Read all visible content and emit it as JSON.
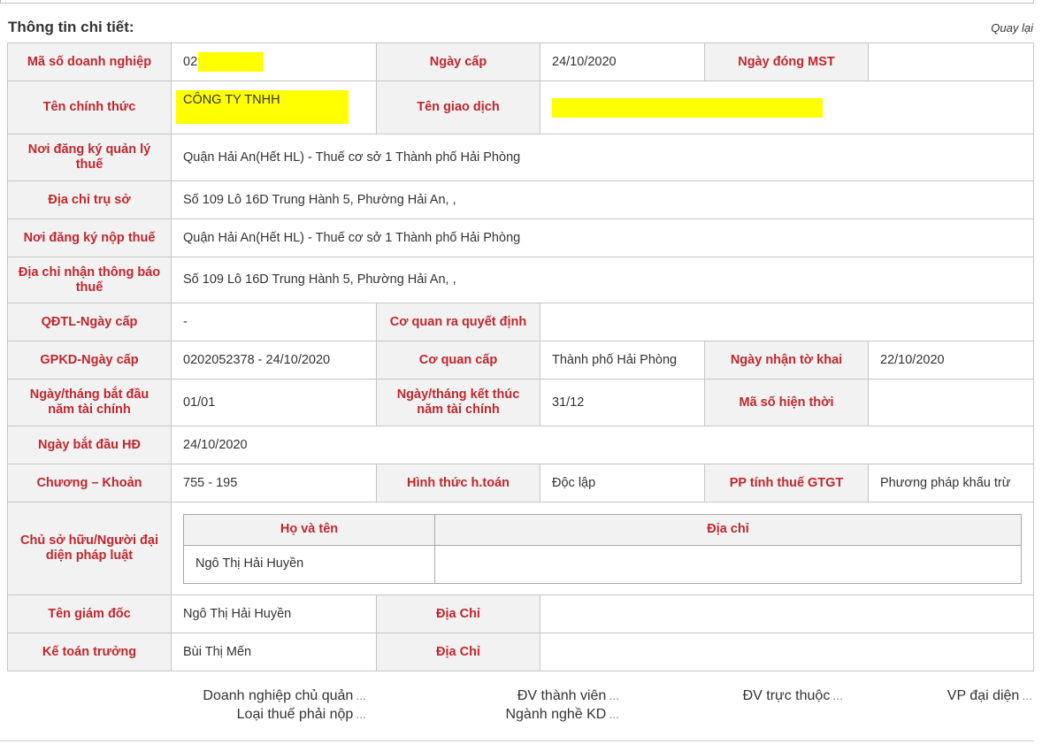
{
  "page": {
    "title": "Thông tin chi tiết:",
    "back_label": "Quay lại"
  },
  "colors": {
    "label": "#c0272d",
    "label_bg": "#f2f2f2",
    "border": "#c6c6c6",
    "redaction": "#ffff00"
  },
  "detail": {
    "ma_so_label": "Mã số doanh nghiệp",
    "ma_so_value": "02",
    "ngay_cap_label": "Ngày cấp",
    "ngay_cap_value": "24/10/2020",
    "ngay_dong_label": "Ngày đóng MST",
    "ngay_dong_value": "",
    "ten_chinh_thuc_label": "Tên chính thức",
    "ten_chinh_thuc_value": "CÔNG TY TNHH",
    "ten_giao_dich_label": "Tên giao dịch",
    "ten_giao_dich_value": "",
    "noi_dk_ql_label": "Nơi đăng ký quản lý thuế",
    "noi_dk_ql_value": "Quận Hải An(Hết HL) - Thuế cơ sở 1 Thành phố Hải Phòng",
    "dia_chi_tru_so_label": "Địa chỉ trụ sở",
    "dia_chi_tru_so_value": "Số 109 Lô 16D Trung Hành 5, Phường Hải An, ,",
    "noi_dk_nop_label": "Nơi đăng ký nộp thuế",
    "noi_dk_nop_value": "Quận Hải An(Hết HL) - Thuế cơ sở 1 Thành phố Hải Phòng",
    "dia_chi_tb_label": "Địa chỉ nhận thông báo thuế",
    "dia_chi_tb_value": "Số 109 Lô 16D Trung Hành 5, Phường Hải An, ,",
    "qdtl_label": "QĐTL-Ngày cấp",
    "qdtl_value": "-",
    "co_quan_qd_label": "Cơ quan ra quyết định",
    "co_quan_qd_value": "",
    "gpkd_label": "GPKD-Ngày cấp",
    "gpkd_value": "0202052378 - 24/10/2020",
    "co_quan_cap_label": "Cơ quan cấp",
    "co_quan_cap_value": "Thành phố Hải Phòng",
    "ngay_nhan_tk_label": "Ngày nhận tờ khai",
    "ngay_nhan_tk_value": "22/10/2020",
    "bat_dau_nam_tc_label": "Ngày/tháng bắt đầu năm tài chính",
    "bat_dau_nam_tc_value": "01/01",
    "ket_thuc_nam_tc_label": "Ngày/tháng kết thúc năm tài chính",
    "ket_thuc_nam_tc_value": "31/12",
    "ma_so_ht_label": "Mã số hiện thời",
    "ma_so_ht_value": "",
    "ngay_bat_dau_hd_label": "Ngày bắt đầu HĐ",
    "ngay_bat_dau_hd_value": "24/10/2020",
    "chuong_khoan_label": "Chương – Khoản",
    "chuong_khoan_value": "755 - 195",
    "hinh_thuc_label": "Hình thức h.toán",
    "hinh_thuc_value": "Độc lập",
    "pp_tinh_thue_label": "PP tính thuế GTGT",
    "pp_tinh_thue_value": "Phương pháp khấu trừ",
    "chu_so_huu_label": "Chủ sở hữu/Người đại diện pháp luật",
    "owner_headers": {
      "name": "Họ và tên",
      "address": "Địa chỉ"
    },
    "owner_rows": [
      {
        "name": "Ngô Thị Hải Huyền",
        "address": ""
      }
    ],
    "giam_doc_label": "Tên giám đốc",
    "giam_doc_value": "Ngô Thị Hải Huyền",
    "giam_doc_dia_chi_label": "Địa Chỉ",
    "giam_doc_dia_chi_value": "",
    "ke_toan_label": "Kế toán trưởng",
    "ke_toan_value": "Bùi Thị Mến",
    "ke_toan_dia_chi_label": "Địa Chỉ",
    "ke_toan_dia_chi_value": ""
  },
  "footer_links": {
    "dn_chu_quan": "Doanh nghiệp chủ quản",
    "loai_thue": "Loại thuế phải nộp",
    "dv_thanh_vien": "ĐV thành viên",
    "nganh_nghe": "Ngành nghề KD",
    "dv_truc_thuoc": "ĐV trực thuộc",
    "vp_dai_dien": "VP đại diện",
    "more": "..."
  }
}
